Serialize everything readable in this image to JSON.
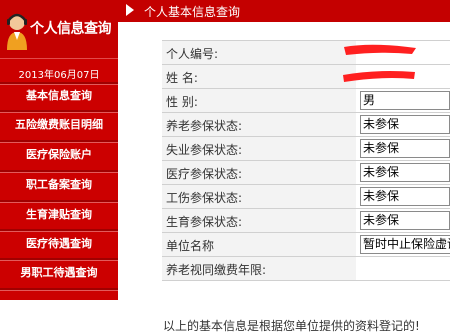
{
  "sidebar": {
    "title": "个人信息查询",
    "date": "2013年06月07日",
    "items": [
      {
        "label": "基本信息查询"
      },
      {
        "label": "五险缴费账目明细"
      },
      {
        "label": "医疗保险账户"
      },
      {
        "label": "职工备案查询"
      },
      {
        "label": "生育津贴查询"
      },
      {
        "label": "医疗待遇查询"
      },
      {
        "label": "男职工待遇查询"
      }
    ]
  },
  "main": {
    "title": "个人基本信息查询",
    "rows": [
      {
        "label": "个人编号:",
        "value": ""
      },
      {
        "label": "姓      名:",
        "value": ""
      },
      {
        "label": "性      别:",
        "value": "男"
      },
      {
        "label": "养老参保状态:",
        "value": "未参保"
      },
      {
        "label": "失业参保状态:",
        "value": "未参保"
      },
      {
        "label": "医疗参保状态:",
        "value": "未参保"
      },
      {
        "label": "工伤参保状态:",
        "value": "未参保"
      },
      {
        "label": "生育参保状态:",
        "value": "未参保"
      },
      {
        "label": "单位名称",
        "value": "暂时中止保险虚设"
      },
      {
        "label": "养老视同缴费年限:",
        "value": ""
      }
    ],
    "footer_note": "以上的基本信息是根据您单位提供的资料登记的!"
  },
  "colors": {
    "sidebar_bg": "#cc0000",
    "header_bg": "#c40000",
    "label_bg": "#f3f3f3",
    "redaction": "#ff2020"
  },
  "icons": {
    "avatar": "user-headset-icon",
    "title_arrow": "triangle-right-icon"
  }
}
